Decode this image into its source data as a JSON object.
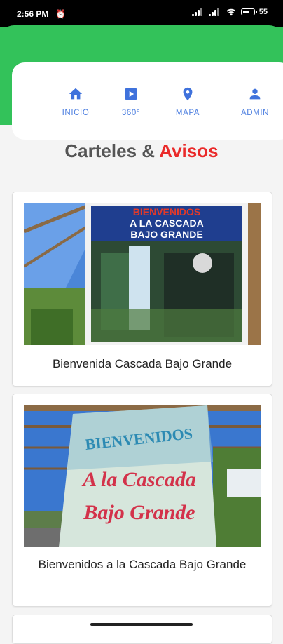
{
  "status_bar": {
    "time": "2:56 PM",
    "battery": "55"
  },
  "nav": {
    "items": [
      {
        "label": "INICIO",
        "icon": "home-icon"
      },
      {
        "label": "360°",
        "icon": "video-icon"
      },
      {
        "label": "MAPA",
        "icon": "map-pin-icon"
      },
      {
        "label": "ADMIN",
        "icon": "person-icon"
      }
    ]
  },
  "page": {
    "title_part1": "Carteles & ",
    "title_part2": "Avisos"
  },
  "cards": [
    {
      "caption": "Bienvenida Cascada Bajo Grande",
      "sign_lines": [
        "BIENVENIDOS",
        "A LA CASCADA",
        "BAJO GRANDE"
      ]
    },
    {
      "caption": "Bienvenidos a la Cascada Bajo Grande",
      "sign_lines": [
        "BIENVENIDOS",
        "A la Cascada",
        "Bajo Grande"
      ]
    }
  ],
  "colors": {
    "header_green": "#33c25a",
    "nav_blue": "#3f72dc",
    "accent_red": "#ea2a2a"
  }
}
